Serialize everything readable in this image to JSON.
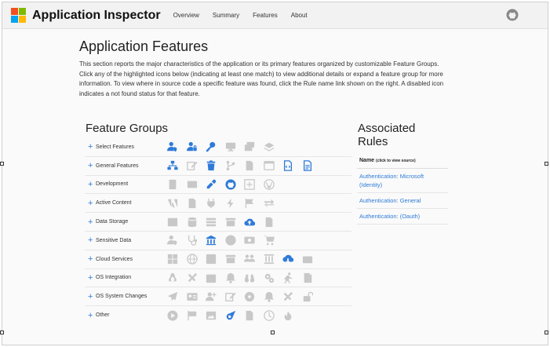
{
  "colors": {
    "active": "#2f7bd8",
    "inactive": "#c8c8c8",
    "logo": [
      "#f25022",
      "#7fba00",
      "#00a4ef",
      "#ffb900"
    ]
  },
  "brand": "Application Inspector",
  "nav": [
    "Overview",
    "Summary",
    "Features",
    "About"
  ],
  "page_title": "Application Features",
  "intro": "This section reports the major characteristics of the application or its primary features organized by customizable Feature Groups. Click any of the highlighted icons below (indicating at least one match) to view additional details or expand a feature group for more information. To view where in source code a specific feature was found, click the Rule name link shown on the right. A disabled icon indicates a not found status for that feature.",
  "groups_title": "Feature Groups",
  "groups": [
    {
      "label": "Select Features",
      "icons": [
        [
          "user-shield-icon",
          true
        ],
        [
          "user-lock-icon",
          true
        ],
        [
          "key-icon",
          true
        ],
        [
          "desktop-icon",
          false
        ],
        [
          "window-stack-icon",
          false
        ],
        [
          "layers-icon",
          false
        ]
      ]
    },
    {
      "label": "General Features",
      "icons": [
        [
          "network-icon",
          true
        ],
        [
          "edit-icon",
          false
        ],
        [
          "trash-icon",
          true
        ],
        [
          "branch-icon",
          false
        ],
        [
          "file-icon",
          false
        ],
        [
          "window-icon",
          false
        ],
        [
          "file-code-icon",
          true
        ],
        [
          "file-text-icon",
          true
        ]
      ]
    },
    {
      "label": "Development",
      "icons": [
        [
          "building-icon",
          false
        ],
        [
          "console-icon",
          false
        ],
        [
          "eyedropper-icon",
          true
        ],
        [
          "github-icon",
          true
        ],
        [
          "plus-box-icon",
          false
        ],
        [
          "wordpress-icon",
          false
        ]
      ]
    },
    {
      "label": "Active Content",
      "icons": [
        [
          "adobe-icon",
          false
        ],
        [
          "file-icon",
          false
        ],
        [
          "plug-icon",
          false
        ],
        [
          "bolt-icon",
          false
        ],
        [
          "flag-icon",
          false
        ],
        [
          "exchange-icon",
          false
        ]
      ]
    },
    {
      "label": "Data Storage",
      "icons": [
        [
          "table-icon",
          false
        ],
        [
          "database-icon",
          false
        ],
        [
          "list-icon",
          false
        ],
        [
          "archive-icon",
          false
        ],
        [
          "cloud-upload-icon",
          true
        ],
        [
          "file-icon",
          false
        ]
      ]
    },
    {
      "label": "Sensitive Data",
      "icons": [
        [
          "user-shield-icon",
          false
        ],
        [
          "stethoscope-icon",
          false
        ],
        [
          "bank-icon",
          true
        ],
        [
          "user-circle-icon",
          false
        ],
        [
          "money-icon",
          false
        ],
        [
          "cart-icon",
          false
        ]
      ]
    },
    {
      "label": "Cloud Services",
      "icons": [
        [
          "windows-icon",
          false
        ],
        [
          "globe-icon",
          false
        ],
        [
          "facebook-icon",
          false
        ],
        [
          "archive-icon",
          false
        ],
        [
          "users-icon",
          false
        ],
        [
          "pillars-icon",
          false
        ],
        [
          "cloud-download-icon",
          true
        ],
        [
          "briefcase-icon",
          false
        ]
      ]
    },
    {
      "label": "OS Integration",
      "icons": [
        [
          "linux-icon",
          false
        ],
        [
          "tools-icon",
          false
        ],
        [
          "calendar-icon",
          false
        ],
        [
          "bell-icon",
          false
        ],
        [
          "binoculars-icon",
          false
        ],
        [
          "cogs-icon",
          false
        ],
        [
          "running-icon",
          false
        ],
        [
          "door-icon",
          false
        ]
      ]
    },
    {
      "label": "OS System Changes",
      "icons": [
        [
          "send-icon",
          false
        ],
        [
          "id-card-icon",
          false
        ],
        [
          "user-plus-icon",
          false
        ],
        [
          "edit-icon",
          false
        ],
        [
          "disc-icon",
          false
        ],
        [
          "bell-icon",
          false
        ],
        [
          "tools-icon",
          false
        ],
        [
          "unlock-icon",
          false
        ]
      ]
    },
    {
      "label": "Other",
      "icons": [
        [
          "play-icon",
          false
        ],
        [
          "flag-checkered-icon",
          false
        ],
        [
          "image-icon",
          false
        ],
        [
          "meteor-icon",
          true
        ],
        [
          "file-icon",
          false
        ],
        [
          "clock-icon",
          false
        ],
        [
          "fire-icon",
          false
        ]
      ]
    }
  ],
  "rules_title": "Associated Rules",
  "rules_header": "Name",
  "rules_header_note": "(click to view source)",
  "rules": [
    "Authentication: Microsoft (Identity)",
    "Authentication: General",
    "Authentication: (Oauth)"
  ]
}
